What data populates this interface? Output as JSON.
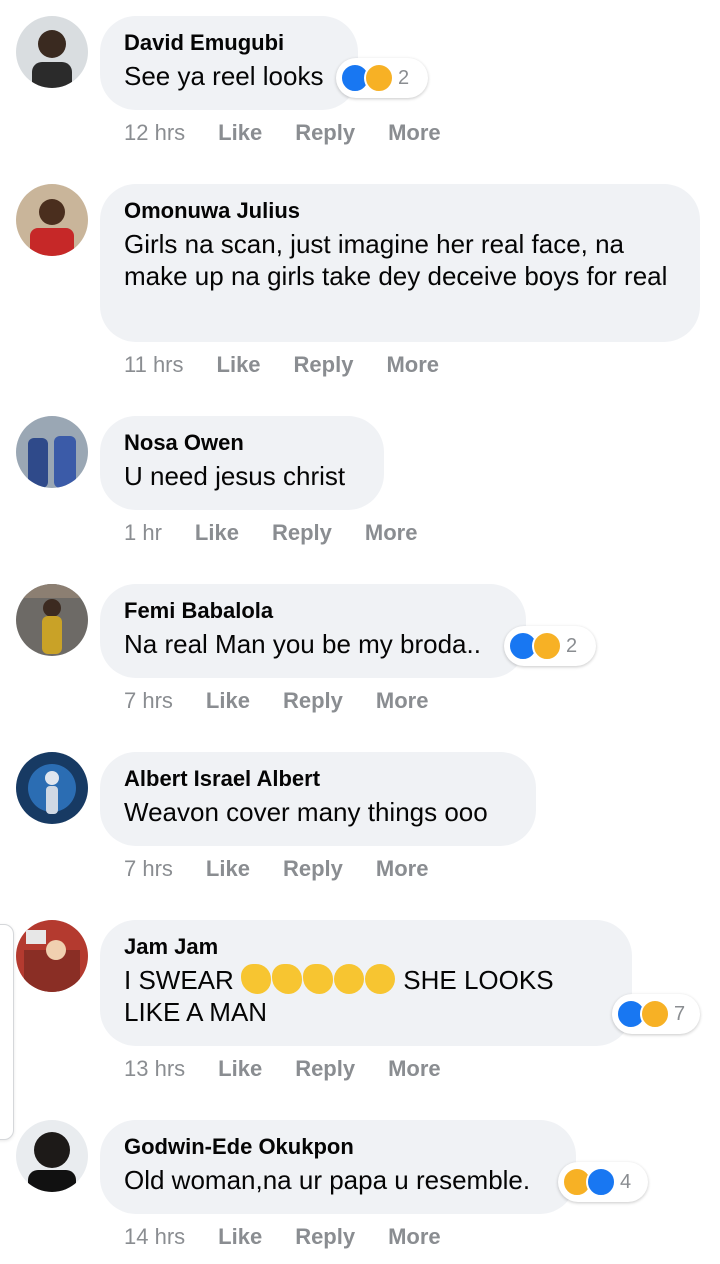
{
  "colors": {
    "bubble": "#f0f2f5",
    "meta": "#8a8d91",
    "like": "#1877f2",
    "haha": "#f7b125"
  },
  "actions": {
    "like": "Like",
    "reply": "Reply",
    "more": "More"
  },
  "comments": [
    {
      "author": "David Emugubi",
      "text": "See ya reel looks",
      "time": "12 hrs",
      "reactions": [
        "like-icon",
        "haha-icon"
      ],
      "reaction_count": "2"
    },
    {
      "author": "Omonuwa Julius",
      "text": "Girls na scan, just imagine her real face, na make up na girls take dey deceive boys for real",
      "time": "11 hrs"
    },
    {
      "author": "Nosa Owen",
      "text": "U need jesus christ",
      "time": "1 hr"
    },
    {
      "author": "Femi Babalola",
      "text": "Na real Man you be my broda..",
      "time": "7 hrs",
      "reactions": [
        "like-icon",
        "haha-icon"
      ],
      "reaction_count": "2"
    },
    {
      "author": "Albert Israel Albert",
      "text": "Weavon cover many things ooo",
      "time": "7 hrs"
    },
    {
      "author": "Jam Jam",
      "text_prefix": "I SWEAR",
      "text_emojis": [
        "waving-hand",
        "waving-hand",
        "waving-hand",
        "grinning-face",
        "grinning-face"
      ],
      "text_suffix": "SHE LOOKS LIKE A MAN",
      "time": "13 hrs",
      "reactions": [
        "like-icon",
        "haha-icon"
      ],
      "reaction_count": "7"
    },
    {
      "author": "Godwin-Ede Okukpon",
      "text": "Old woman,na ur papa u resemble.",
      "time": "14 hrs",
      "reactions": [
        "haha-icon",
        "like-icon"
      ],
      "reaction_count": "4"
    }
  ]
}
